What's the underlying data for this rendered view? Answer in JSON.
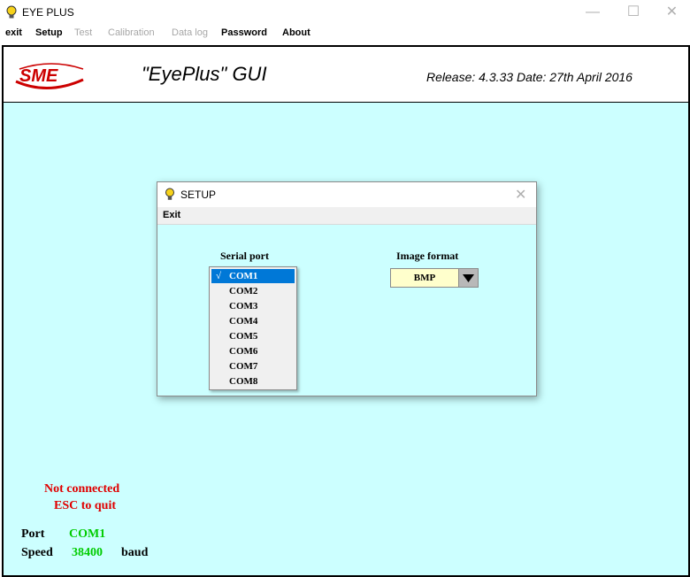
{
  "window": {
    "title": "EYE PLUS",
    "minimize_glyph": "—",
    "maximize_glyph": "☐",
    "close_glyph": "✕"
  },
  "menubar": {
    "items": [
      {
        "label": "exit",
        "enabled": true
      },
      {
        "label": "Setup",
        "enabled": true
      },
      {
        "label": "Test",
        "enabled": false
      },
      {
        "label": "Calibration",
        "enabled": false
      },
      {
        "label": "Data log",
        "enabled": false
      },
      {
        "label": "Password",
        "enabled": true
      },
      {
        "label": "About",
        "enabled": true
      }
    ]
  },
  "header": {
    "logo_text": "SME",
    "app_title": "\"EyePlus\" GUI",
    "release": "Release: 4.3.33  Date: 27th April 2016"
  },
  "status": {
    "connection": "Not connected",
    "quit_hint": "ESC to quit",
    "port_label": "Port",
    "port_value": "COM1",
    "speed_label": "Speed",
    "speed_value": "38400",
    "speed_unit": "baud"
  },
  "dialog": {
    "title": "SETUP",
    "close_glyph": "✕",
    "menu_exit": "Exit",
    "serial_port_label": "Serial port",
    "check_glyph": "√",
    "ports": [
      "COM1",
      "COM2",
      "COM3",
      "COM4",
      "COM5",
      "COM6",
      "COM7",
      "COM8"
    ],
    "selected_port_index": 0,
    "image_format_label": "Image format",
    "image_format_value": "BMP"
  },
  "colors": {
    "background": "#ccffff",
    "status_red": "#e00000",
    "value_green": "#00cc00",
    "selection_blue": "#0078d7",
    "combo_yellow": "#ffffcc"
  }
}
